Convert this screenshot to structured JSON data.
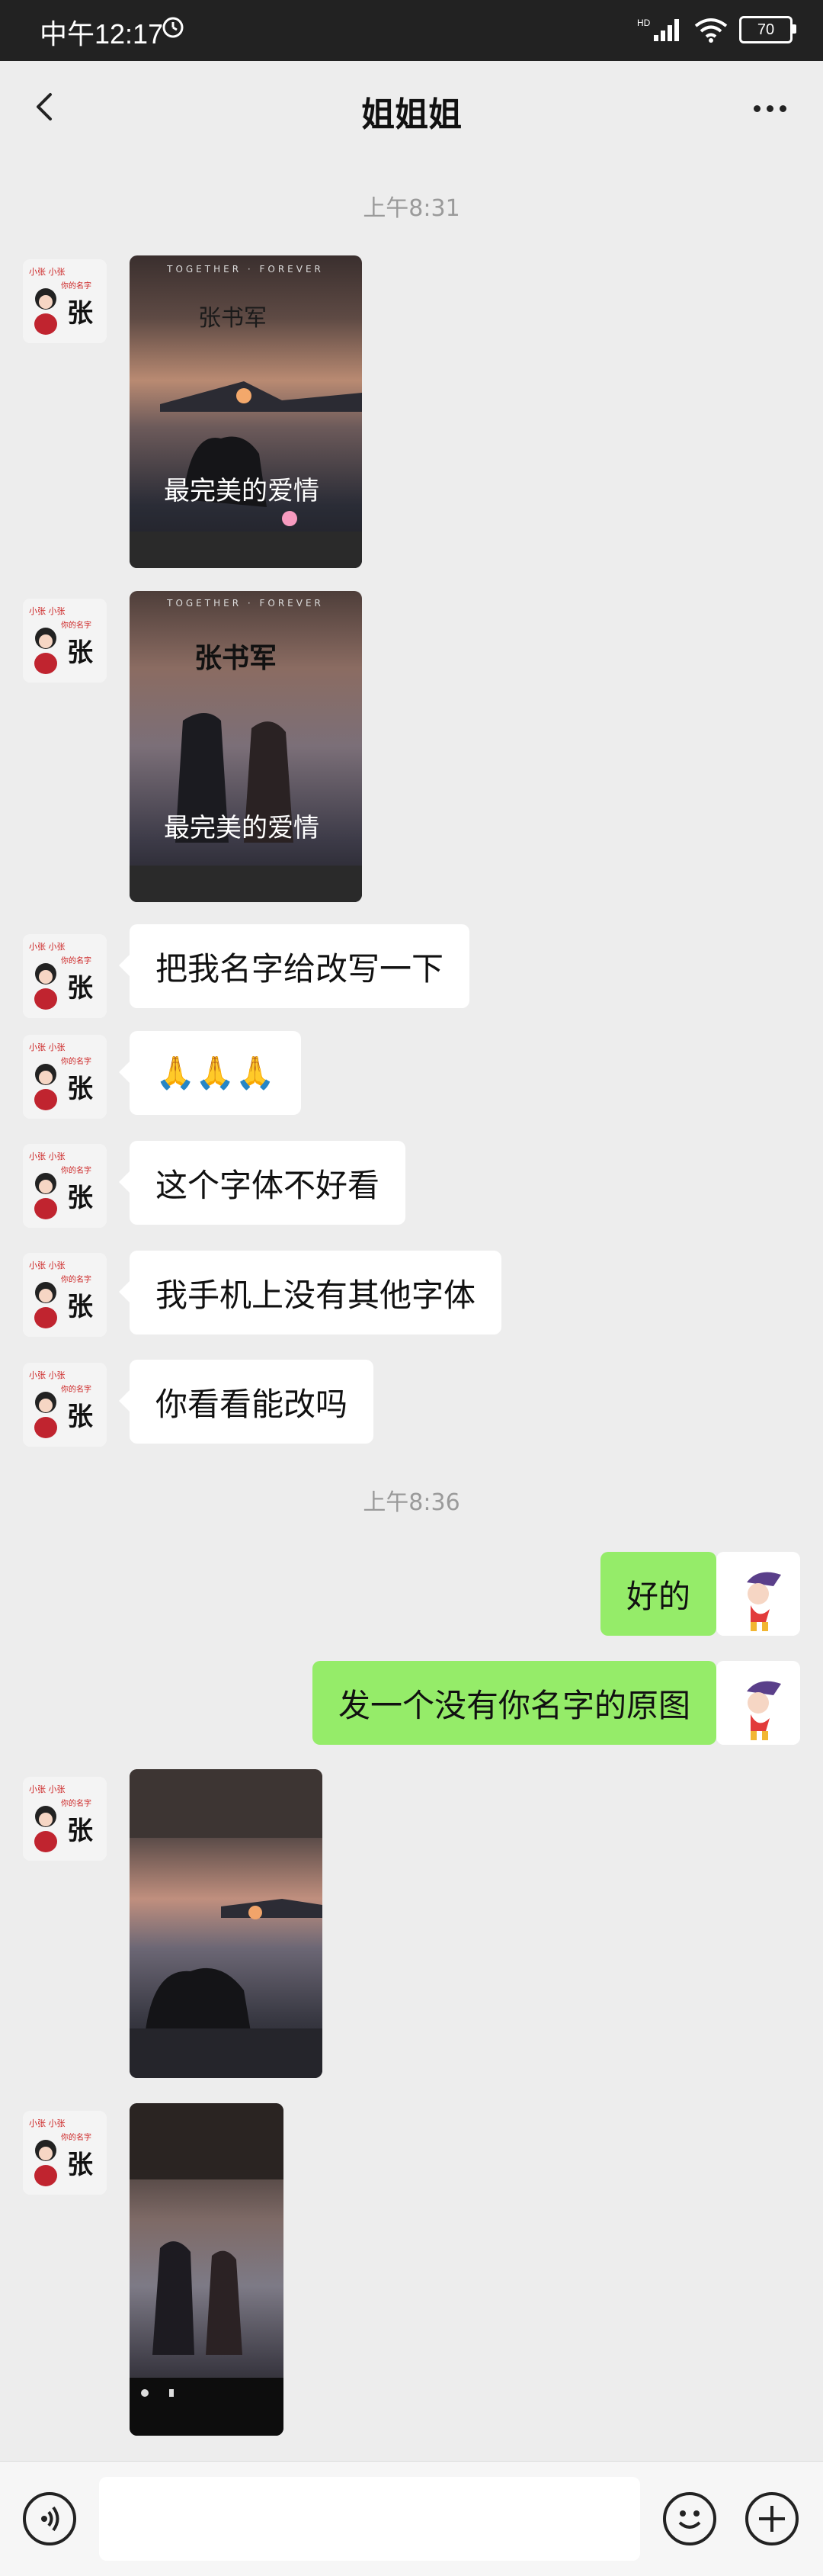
{
  "status_bar": {
    "time": "中午12:17",
    "signal_label": "HD",
    "battery": "70"
  },
  "header": {
    "title": "姐姐姐"
  },
  "messages": {
    "ts1": "上午8:31",
    "text1": "把我名字给改写一下",
    "text2": "🙏🙏🙏",
    "text3": "这个字体不好看",
    "text4": "我手机上没有其他字体",
    "text5": "你看看能改吗",
    "ts2": "上午8:36",
    "reply1": "好的",
    "reply2": "发一个没有你名字的原图"
  },
  "images": {
    "poster_header": "TOGETHER · FOREVER",
    "poster1_name": "张书军",
    "poster2_name": "张书军",
    "poster_script": "最完美的爱情"
  },
  "avatar_left": {
    "line1": "小张 小张",
    "line2": "你的名字",
    "char": "张"
  },
  "colors": {
    "bg": "#ededed",
    "bubble_left": "#ffffff",
    "bubble_right": "#95ec69",
    "timestamp": "#9a9a9a"
  }
}
